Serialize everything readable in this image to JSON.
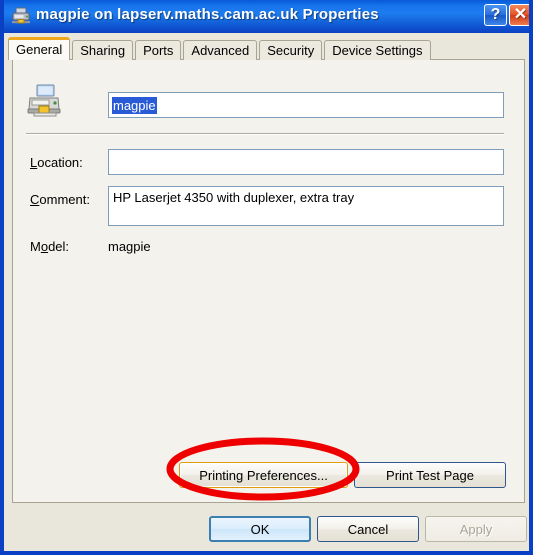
{
  "window": {
    "title": "magpie on lapserv.maths.cam.ac.uk Properties",
    "title_icon": "printer-icon",
    "help_glyph": "?",
    "close_glyph": "✕",
    "accent_title_bg": "#1774ec",
    "frame_border": "#0a41c4"
  },
  "tabs": [
    {
      "label": "General",
      "active": true
    },
    {
      "label": "Sharing",
      "active": false
    },
    {
      "label": "Ports",
      "active": false
    },
    {
      "label": "Advanced",
      "active": false
    },
    {
      "label": "Security",
      "active": false
    },
    {
      "label": "Device Settings",
      "active": false
    }
  ],
  "general": {
    "printer_icon": "printer-icon",
    "name_value": "magpie",
    "name_selected": true,
    "location": {
      "label_pre": "L",
      "label_accel": "",
      "label_full": "Location:",
      "value": "",
      "placeholder": ""
    },
    "comment": {
      "label_full": "Comment:",
      "value": "HP Laserjet 4350 with duplexer, extra tray",
      "placeholder": ""
    },
    "model": {
      "label_full": "Model:",
      "value": "magpie"
    },
    "printing_preferences_button": "Printing Preferences...",
    "print_test_page_button": "Print Test Page"
  },
  "footer": {
    "ok_label": "OK",
    "cancel_label": "Cancel",
    "apply_label": "Apply",
    "apply_enabled": false
  },
  "annotation": {
    "shape": "ellipse",
    "color": "#ee0000",
    "target": "Printing Preferences..."
  }
}
